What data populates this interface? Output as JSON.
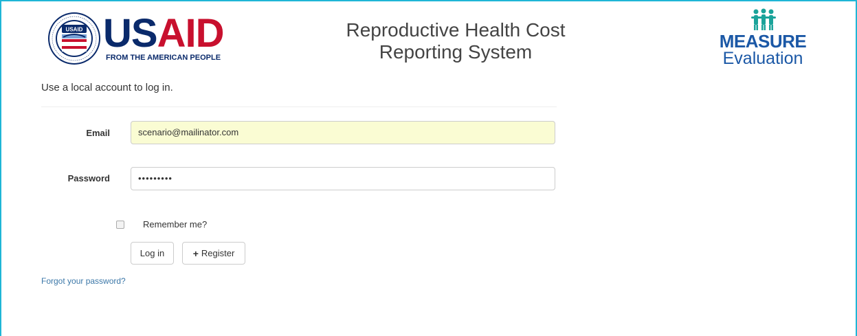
{
  "header": {
    "usaid_logo": {
      "seal_text": "UNITED STATES AGENCY INTERNATIONAL DEVELOPMENT",
      "seal_badge": "USAID",
      "word_us": "US",
      "word_aid": "AID",
      "tagline": "FROM THE AMERICAN PEOPLE"
    },
    "title_line1": "Reproductive Health Cost",
    "title_line2": "Reporting System",
    "measure_logo": {
      "word": "MEASURE",
      "sub": "Evaluation"
    }
  },
  "form": {
    "intro": "Use a local account to log in.",
    "email_label": "Email",
    "email_value": "scenario@mailinator.com",
    "password_label": "Password",
    "password_value": "•••••••••",
    "remember_label": "Remember me?",
    "remember_checked": false,
    "login_label": "Log in",
    "register_label": "Register",
    "forgot_link": "Forgot your password?"
  },
  "colors": {
    "frame_border": "#1fb6d6",
    "usaid_blue": "#0a2a6b",
    "usaid_red": "#c8102e",
    "measure_blue": "#1b58a6",
    "measure_teal": "#1aa39a",
    "autofill_bg": "#fafcd3",
    "link": "#3b77a8"
  }
}
